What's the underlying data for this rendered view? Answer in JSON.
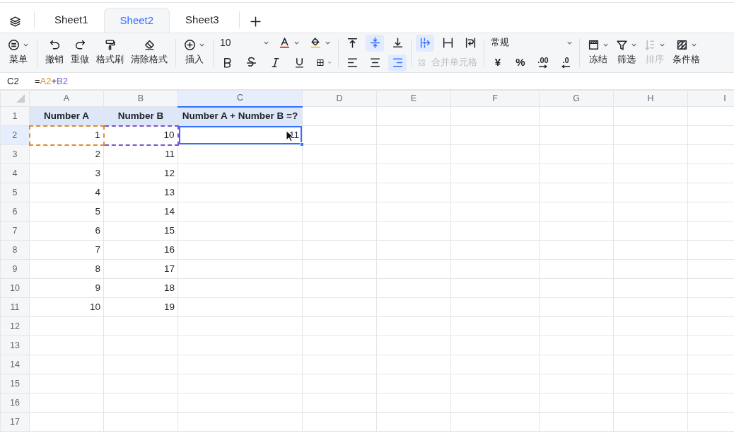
{
  "tabs": [
    {
      "label": "Sheet1",
      "selected": false
    },
    {
      "label": "Sheet2",
      "selected": true
    },
    {
      "label": "Sheet3",
      "selected": false
    }
  ],
  "toolbar": {
    "left_buttons": [
      {
        "label": "菜单",
        "dropdown": true
      },
      {
        "label": "撤销",
        "dropdown": false
      },
      {
        "label": "重做",
        "dropdown": false
      },
      {
        "label": "格式刷",
        "dropdown": false
      },
      {
        "label": "清除格式",
        "dropdown": false
      },
      {
        "label": "插入",
        "dropdown": true
      }
    ],
    "font_size": "10",
    "vertical_align": [
      {
        "selected": false
      },
      {
        "selected": true
      },
      {
        "selected": false
      }
    ],
    "horizontal_align": [
      {
        "selected": false
      },
      {
        "selected": false
      },
      {
        "selected": true
      }
    ],
    "text_wrap": [
      {
        "selected": true
      },
      {
        "selected": false
      },
      {
        "selected": false
      }
    ],
    "merge": {
      "label": "合并单元格",
      "disabled": true
    },
    "number_format": "常规",
    "number_buttons": [
      {
        "label": "¥",
        "kind": "plain"
      },
      {
        "label": "%",
        "kind": "plain"
      },
      {
        "label": ".00",
        "kind": "increase"
      },
      {
        "label": ".0",
        "kind": "decrease"
      }
    ],
    "right_buttons": [
      {
        "label": "冻结",
        "disabled": false
      },
      {
        "label": "筛选",
        "disabled": false
      },
      {
        "label": "排序",
        "disabled": true
      },
      {
        "label": "条件格",
        "disabled": false
      }
    ]
  },
  "formula_bar": {
    "cell": "C2",
    "parts": [
      {
        "text": "=",
        "color": "#1f2329"
      },
      {
        "text": "A2",
        "color": "#de8a2f"
      },
      {
        "text": "+",
        "color": "#1f2329"
      },
      {
        "text": "B2",
        "color": "#7a55d0"
      }
    ]
  },
  "grid": {
    "columns": [
      {
        "label": "A",
        "selected": false
      },
      {
        "label": "B",
        "selected": false
      },
      {
        "label": "C",
        "selected": true
      },
      {
        "label": "D",
        "selected": false
      },
      {
        "label": "E",
        "selected": false
      },
      {
        "label": "F",
        "selected": false
      },
      {
        "label": "G",
        "selected": false
      },
      {
        "label": "H",
        "selected": false
      },
      {
        "label": "I",
        "selected": false
      }
    ],
    "rows": [
      {
        "label": "1",
        "selected": false,
        "kind": "header",
        "cells": [
          "Number A",
          "Number B",
          "Number A + Number B =?"
        ]
      },
      {
        "label": "2",
        "selected": true,
        "kind": "data",
        "cells": [
          {
            "text": "1",
            "color": "#de8a2f"
          },
          {
            "text": "10",
            "color": "#7a55d0"
          },
          {
            "text": "11",
            "active": true
          }
        ]
      },
      {
        "label": "3",
        "selected": false,
        "kind": "data",
        "cells": [
          "2",
          "11"
        ]
      },
      {
        "label": "4",
        "selected": false,
        "kind": "data",
        "cells": [
          "3",
          "12"
        ]
      },
      {
        "label": "5",
        "selected": false,
        "kind": "data",
        "cells": [
          "4",
          "13"
        ]
      },
      {
        "label": "6",
        "selected": false,
        "kind": "data",
        "cells": [
          "5",
          "14"
        ]
      },
      {
        "label": "7",
        "selected": false,
        "kind": "data",
        "cells": [
          "6",
          "15"
        ]
      },
      {
        "label": "8",
        "selected": false,
        "kind": "data",
        "cells": [
          "7",
          "16"
        ]
      },
      {
        "label": "9",
        "selected": false,
        "kind": "data",
        "cells": [
          "8",
          "17"
        ]
      },
      {
        "label": "10",
        "selected": false,
        "kind": "data",
        "cells": [
          "9",
          "18"
        ]
      },
      {
        "label": "11",
        "selected": false,
        "kind": "data",
        "cells": [
          "10",
          "19"
        ]
      },
      {
        "label": "12",
        "selected": false,
        "kind": "data"
      },
      {
        "label": "13",
        "selected": false,
        "kind": "data"
      },
      {
        "label": "14",
        "selected": false,
        "kind": "data"
      },
      {
        "label": "15",
        "selected": false,
        "kind": "data"
      },
      {
        "label": "16",
        "selected": false,
        "kind": "data"
      },
      {
        "label": "17",
        "selected": false,
        "kind": "data"
      }
    ]
  }
}
